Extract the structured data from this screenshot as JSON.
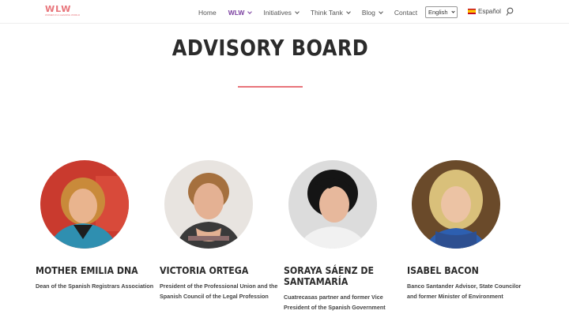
{
  "header": {
    "logo_mark": "WLW",
    "logo_tagline": "WOMEN IN A LEADING WORLD",
    "nav": [
      {
        "label": "Home",
        "dropdown": false
      },
      {
        "label": "WLW",
        "dropdown": true,
        "active": true
      },
      {
        "label": "Initiatives",
        "dropdown": true
      },
      {
        "label": "Think Tank",
        "dropdown": true
      },
      {
        "label": "Blog",
        "dropdown": true
      },
      {
        "label": "Contact",
        "dropdown": false
      }
    ],
    "language_select": "English",
    "language_alt": "Español",
    "flag_icon": "spain-flag-icon",
    "search_icon": "search-icon"
  },
  "page": {
    "title": "ADVISORY BOARD",
    "accent_color": "#e8747a"
  },
  "members": [
    {
      "name": "MOTHER EMILIA DNA",
      "role": "Dean of the Spanish Registrars Association"
    },
    {
      "name": "VICTORIA ORTEGA",
      "role": "President of the Professional Union and the Spanish Council of the Legal Profession"
    },
    {
      "name": "SORAYA SÁENZ DE SANTAMARÍA",
      "role": "Cuatrecasas partner and former Vice President of the Spanish Government"
    },
    {
      "name": "ISABEL BACON",
      "role": "Banco Santander Advisor, State Councilor and former Minister of Environment"
    }
  ]
}
